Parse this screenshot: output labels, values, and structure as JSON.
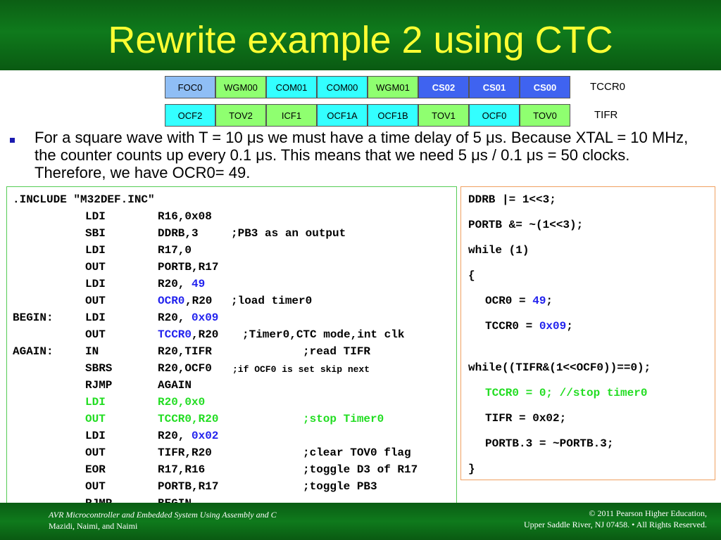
{
  "slide": {
    "title": "Rewrite example 2 using CTC",
    "bullet": "For a square wave with T = 10 μs we must have a time delay of 5 μs. Because XTAL = 10 MHz, the counter counts up every 0.1 μs. This means that we need 5 μs / 0.1 μs =  50 clocks. Therefore, we have OCR0= 49."
  },
  "registers": {
    "tccr0": {
      "label": "TCCR0",
      "bits": [
        "FOC0",
        "WGM00",
        "COM01",
        "COM00",
        "WGM01",
        "CS02",
        "CS01",
        "CS00"
      ]
    },
    "tifr": {
      "label": "TIFR",
      "bits": [
        "OCF2",
        "TOV2",
        "ICF1",
        "OCF1A",
        "OCF1B",
        "TOV1",
        "OCF0",
        "TOV0"
      ]
    }
  },
  "asm": {
    "lines": [
      {
        "label": ".INCLUDE \"M32DEF.INC\"",
        "op": "",
        "arg": "",
        "comment": ""
      },
      {
        "label": "",
        "op": "LDI",
        "arg": "R16,0x08",
        "comment": ""
      },
      {
        "label": "",
        "op": "SBI",
        "arg": "DDRB,3",
        "comment": ";PB3 as an output"
      },
      {
        "label": "",
        "op": "LDI",
        "arg": "R17,0",
        "comment": ""
      },
      {
        "label": "",
        "op": "OUT",
        "arg": "PORTB,R17",
        "comment": ""
      },
      {
        "label": "",
        "op": "LDI",
        "arg": "R20,",
        "arg2": "49",
        "comment": ""
      },
      {
        "label": "",
        "op": "OUT",
        "arg": "OCR0",
        "arg2": ",R20",
        "comment": ";load timer0"
      },
      {
        "label": "BEGIN:",
        "op": "LDI",
        "arg": "R20,",
        "arg2": "0x09",
        "comment": ""
      },
      {
        "label": "",
        "op": "OUT",
        "arg": "TCCR0",
        "arg2": ",R20",
        "comment": ";Timer0,CTC mode,int clk"
      },
      {
        "label": "AGAIN:",
        "op": "IN",
        "arg": "R20,TIFR",
        "comment": ";read TIFR"
      },
      {
        "label": "",
        "op": "SBRS",
        "arg": "R20,OCF0",
        "comment": ";if OCF0 is set skip next"
      },
      {
        "label": "",
        "op": "RJMP",
        "arg": "AGAIN",
        "comment": ""
      },
      {
        "label": "",
        "op": "LDI",
        "arg": "R20,0x0",
        "comment": ""
      },
      {
        "label": "",
        "op": "OUT",
        "arg": "TCCR0,R20",
        "comment": ";stop Timer0"
      },
      {
        "label": "",
        "op": "LDI",
        "arg": "R20,",
        "arg2": "0x02",
        "comment": ""
      },
      {
        "label": "",
        "op": "OUT",
        "arg": "TIFR,R20",
        "comment": ";clear TOV0 flag"
      },
      {
        "label": "",
        "op": "EOR",
        "arg": "R17,R16",
        "comment": ";toggle D3 of R17"
      },
      {
        "label": "",
        "op": "OUT",
        "arg": "PORTB,R17",
        "comment": ";toggle PB3"
      },
      {
        "label": "",
        "op": "RJMP",
        "arg": "BEGIN",
        "comment": ""
      }
    ]
  },
  "c_code": {
    "lines": [
      {
        "text": "DDRB |= 1<<3;"
      },
      {
        "text": "PORTB &= ~(1<<3);"
      },
      {
        "text": "while (1)"
      },
      {
        "text": "{"
      },
      {
        "text": "OCR0 = ",
        "num": "49",
        "tail": ";"
      },
      {
        "text": "TCCR0 = ",
        "num": "0x09",
        "tail": ";"
      },
      {
        "text": "while((TIFR&(1<<OCF0))==0);"
      },
      {
        "text": "TCCR0 = 0; //stop timer0"
      },
      {
        "text": "TIFR = 0x02;"
      },
      {
        "text": "PORTB.3 = ~PORTB.3;"
      },
      {
        "text": "}"
      }
    ]
  },
  "footer": {
    "left_line1": "AVR Microcontroller and Embedded System Using Assembly and C",
    "left_line2": "Mazidi, Naimi, and Naimi",
    "right_line1": "© 2011   Pearson Higher Education,",
    "right_line2": "Upper Saddle River, NJ 07458. • All Rights Reserved."
  }
}
